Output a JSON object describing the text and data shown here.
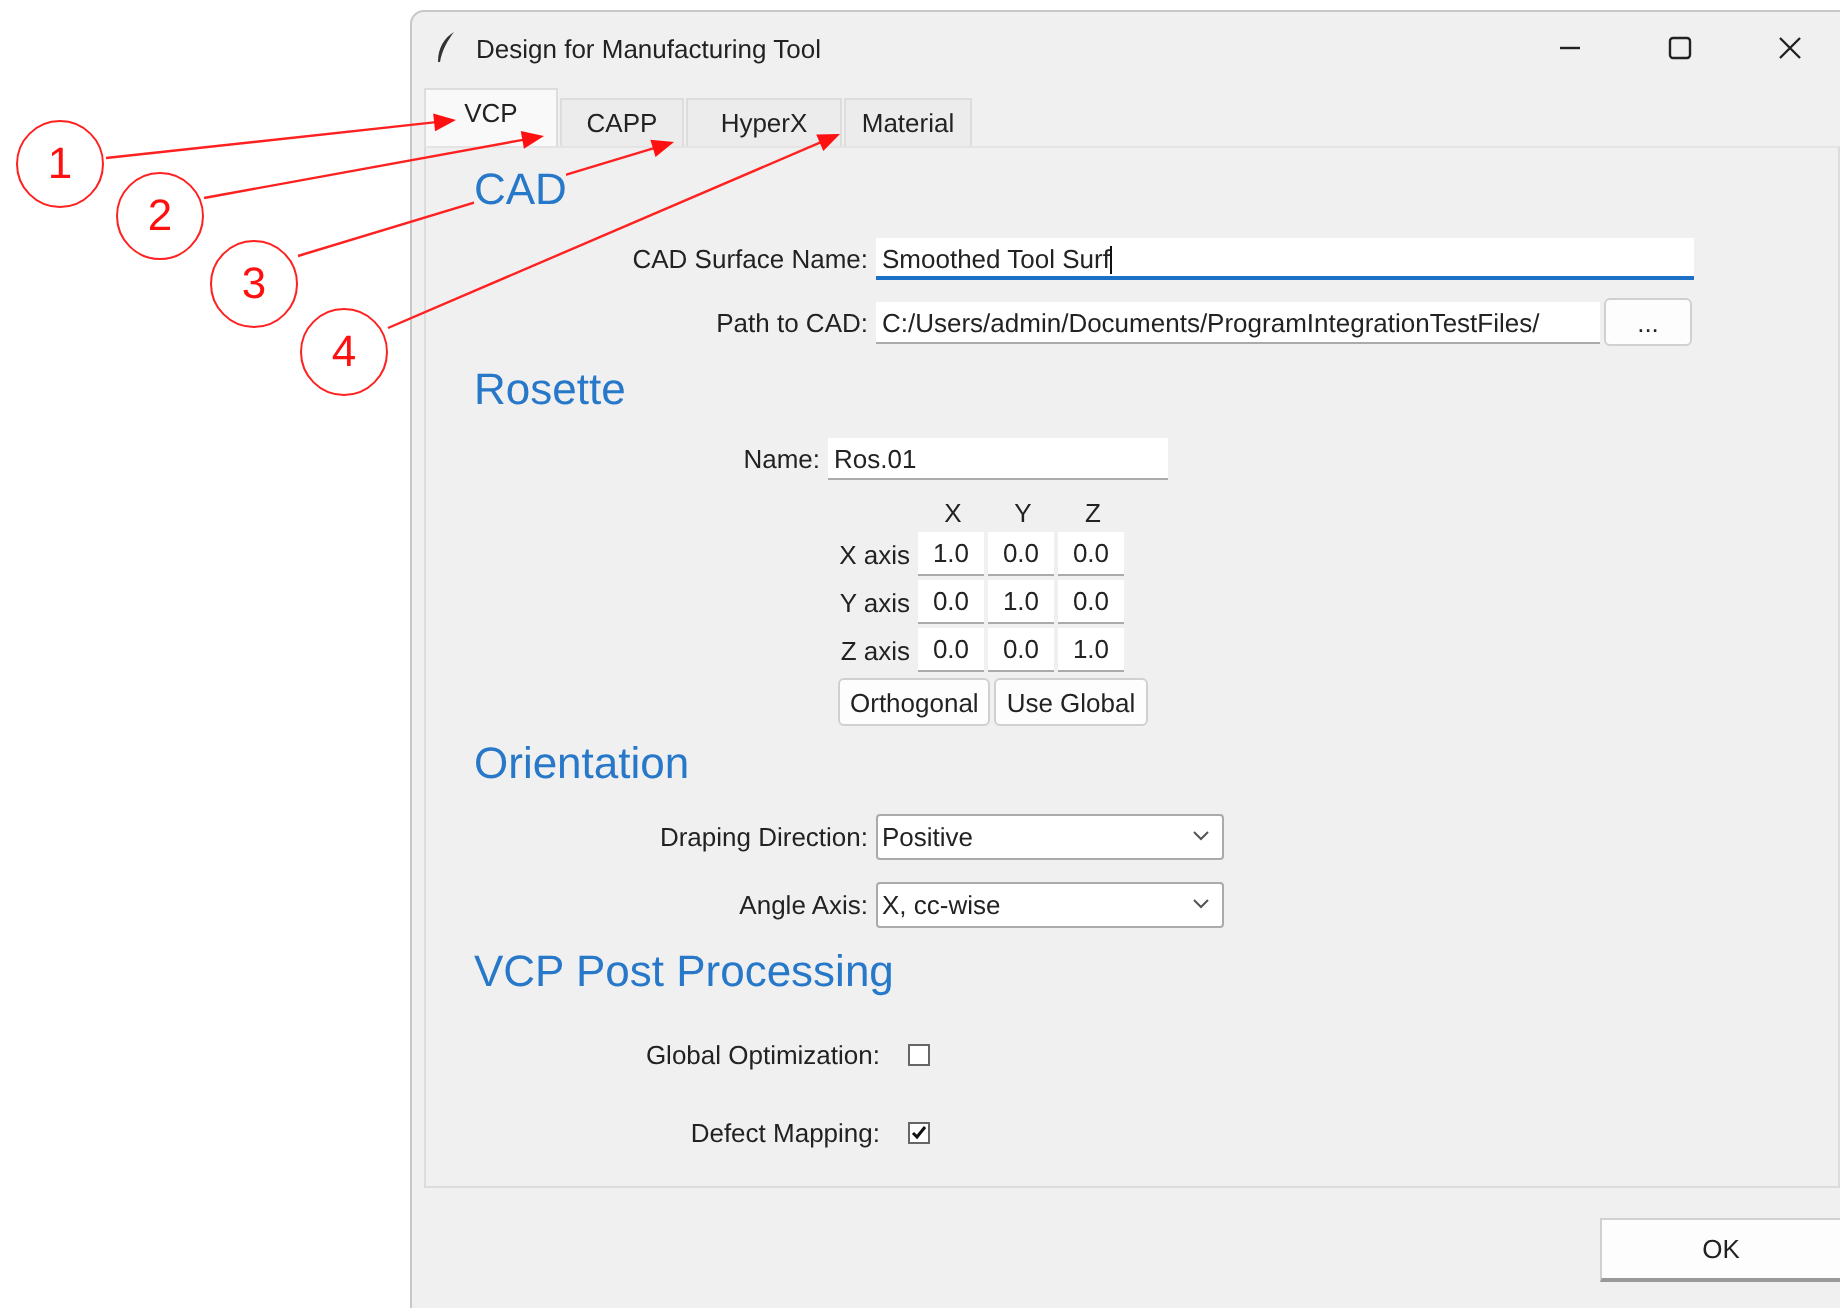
{
  "window": {
    "title": "Design for Manufacturing Tool"
  },
  "tabs": [
    {
      "label": "VCP",
      "selected": true
    },
    {
      "label": "CAPP",
      "selected": false
    },
    {
      "label": "HyperX",
      "selected": false
    },
    {
      "label": "Material",
      "selected": false
    }
  ],
  "cad": {
    "title": "CAD",
    "fields": [
      {
        "label": "CAD Surface Name:",
        "value": "Smoothed Tool Surf",
        "focused": true
      },
      {
        "label": "Path to CAD:",
        "value": "C:/Users/admin/Documents/ProgramIntegrationTestFiles/",
        "focused": false,
        "button": "..."
      }
    ]
  },
  "rosette": {
    "title": "Rosette",
    "name_label": "Name:",
    "name": "Ros.01",
    "columns": [
      "X",
      "Y",
      "Z"
    ],
    "rows": [
      {
        "label": "X axis",
        "values": [
          "1.0",
          "0.0",
          "0.0"
        ]
      },
      {
        "label": "Y axis",
        "values": [
          "0.0",
          "1.0",
          "0.0"
        ]
      },
      {
        "label": "Z axis",
        "values": [
          "0.0",
          "0.0",
          "1.0"
        ]
      }
    ],
    "buttons": [
      "Orthogonal",
      "Use Global"
    ]
  },
  "orientation": {
    "title": "Orientation",
    "selects": [
      {
        "label": "Draping Direction:",
        "value": "Positive"
      },
      {
        "label": "Angle Axis:",
        "value": "X, cc-wise"
      }
    ]
  },
  "post_processing": {
    "title": "VCP Post Processing",
    "options": [
      {
        "label": "Global Optimization:",
        "checked": false
      },
      {
        "label": "Defect Mapping:",
        "checked": true
      }
    ]
  },
  "ok_button": "OK",
  "annotations": [
    {
      "label": "1"
    },
    {
      "label": "2"
    },
    {
      "label": "3"
    },
    {
      "label": "4"
    }
  ]
}
